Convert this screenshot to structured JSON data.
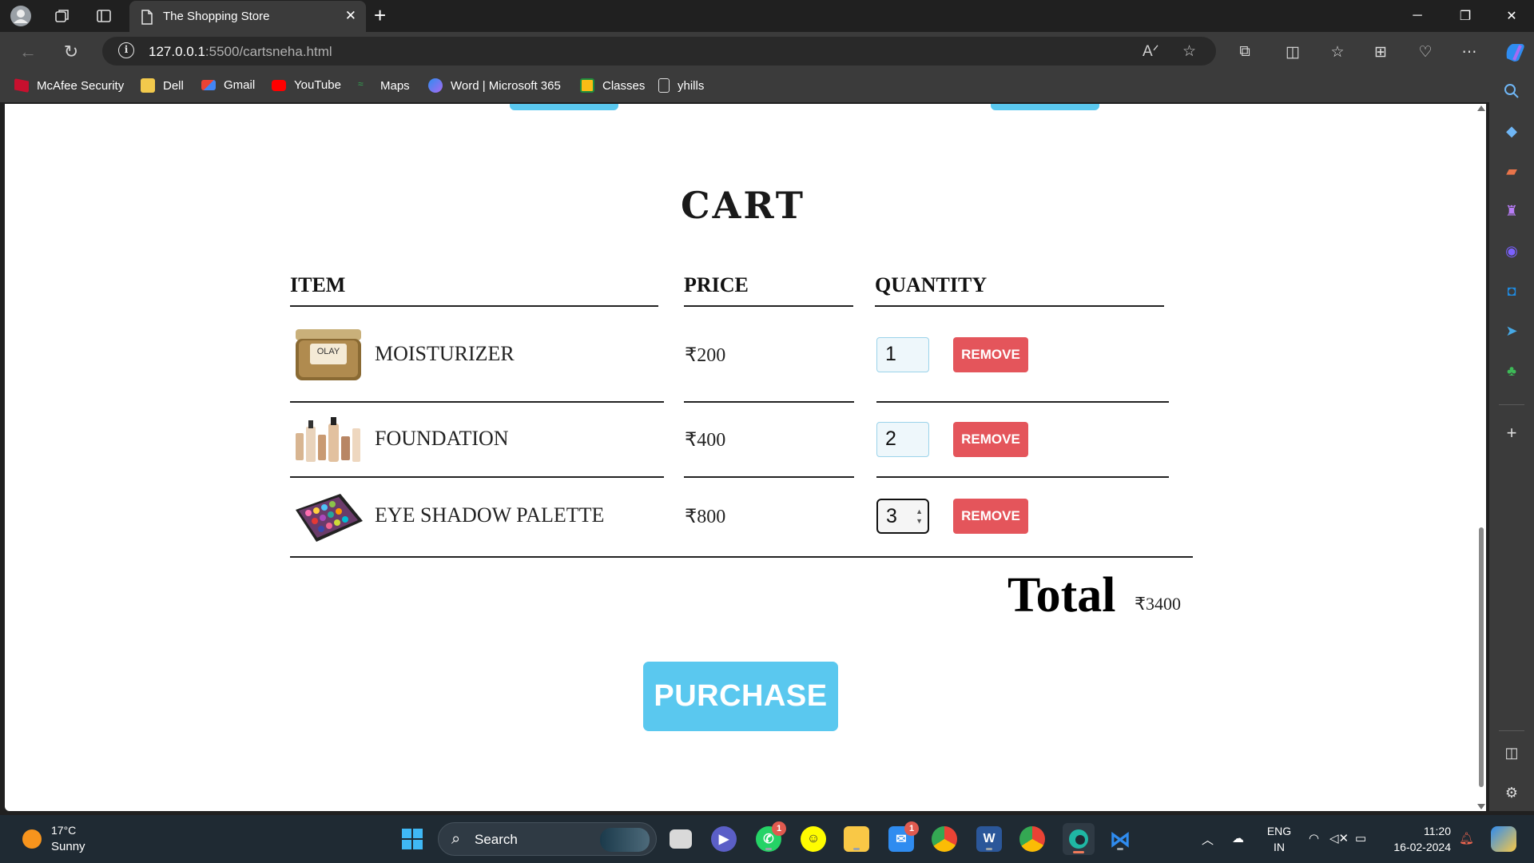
{
  "browser": {
    "tab_title": "The Shopping Store",
    "url_host": "127.0.0.1",
    "url_path": ":5500/cartsneha.html",
    "bookmarks": [
      {
        "label": "McAfee Security",
        "icon": "mcafee-icon",
        "color": "#c8102e"
      },
      {
        "label": "Dell",
        "icon": "folder-icon",
        "color": "#f2c94c"
      },
      {
        "label": "Gmail",
        "icon": "gmail-icon",
        "color": "#ea4335"
      },
      {
        "label": "YouTube",
        "icon": "youtube-icon",
        "color": "#ff0000"
      },
      {
        "label": "Maps",
        "icon": "maps-icon",
        "color": "#34a853"
      },
      {
        "label": "Word | Microsoft 365",
        "icon": "m365-icon",
        "color": "#7b61ff"
      },
      {
        "label": "Classes",
        "icon": "classroom-icon",
        "color": "#f9bc15"
      },
      {
        "label": "yhills",
        "icon": "page-icon",
        "color": "#ffffff"
      }
    ]
  },
  "page": {
    "title": "CART",
    "headers": {
      "item": "ITEM",
      "price": "PRICE",
      "quantity": "QUANTITY"
    },
    "items": [
      {
        "name": "MOISTURIZER",
        "price": "₹200",
        "quantity": "1",
        "remove_label": "REMOVE",
        "image": "moisturizer-jar"
      },
      {
        "name": "FOUNDATION",
        "price": "₹400",
        "quantity": "2",
        "remove_label": "REMOVE",
        "image": "foundation-bottles"
      },
      {
        "name": "EYE SHADOW PALETTE",
        "price": "₹800",
        "quantity": "3",
        "remove_label": "REMOVE",
        "image": "eyeshadow-palette"
      }
    ],
    "total_label": "Total",
    "total_value": "₹3400",
    "purchase_label": "PURCHASE",
    "accent_color": "#5ac8ef",
    "remove_color": "#e4555b"
  },
  "taskbar": {
    "weather_temp": "17°C",
    "weather_desc": "Sunny",
    "search_label": "Search",
    "lang_top": "ENG",
    "lang_bottom": "IN",
    "time": "11:20",
    "date": "16-02-2024",
    "whatsapp_badge": "1",
    "mail_badge": "1"
  }
}
